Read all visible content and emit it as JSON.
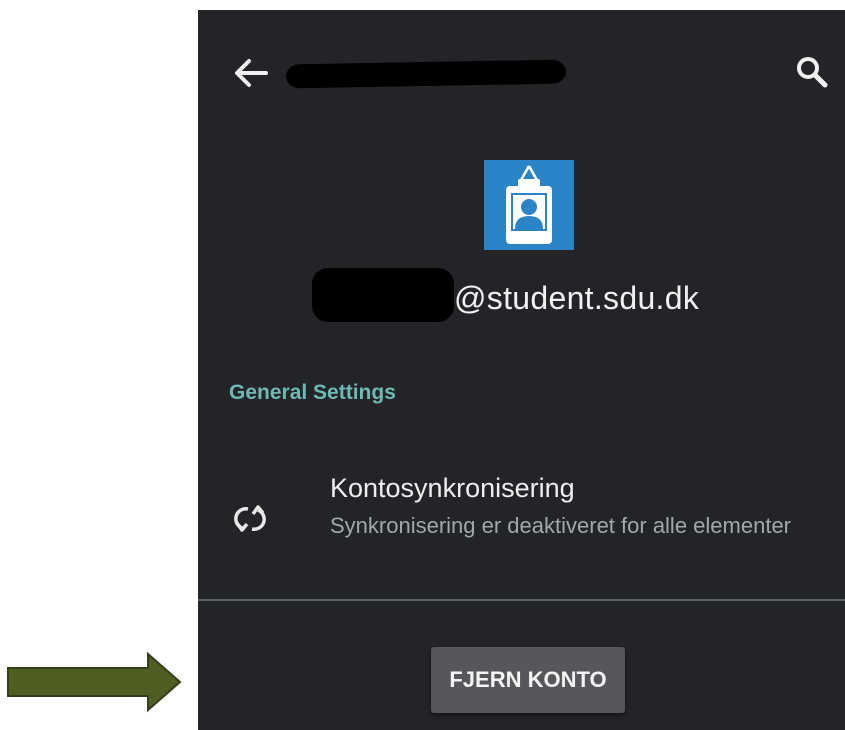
{
  "appbar": {
    "back_icon": "arrow-left-icon",
    "search_icon": "search-icon"
  },
  "account": {
    "avatar_icon": "id-badge-icon",
    "avatar_color": "#2a84c6",
    "email_suffix": "@student.sdu.dk"
  },
  "general_settings": {
    "title": "General Settings",
    "title_color": "#6fb9b4",
    "items": [
      {
        "icon": "sync-icon",
        "title": "Kontosynkronisering",
        "subtitle": "Synkronisering er deaktiveret for alle elementer"
      }
    ]
  },
  "footer": {
    "remove_button_label": "FJERN KONTO"
  },
  "annotation": {
    "arrow_icon": "arrow-right-annotation",
    "arrow_color": "#4f5e23"
  }
}
